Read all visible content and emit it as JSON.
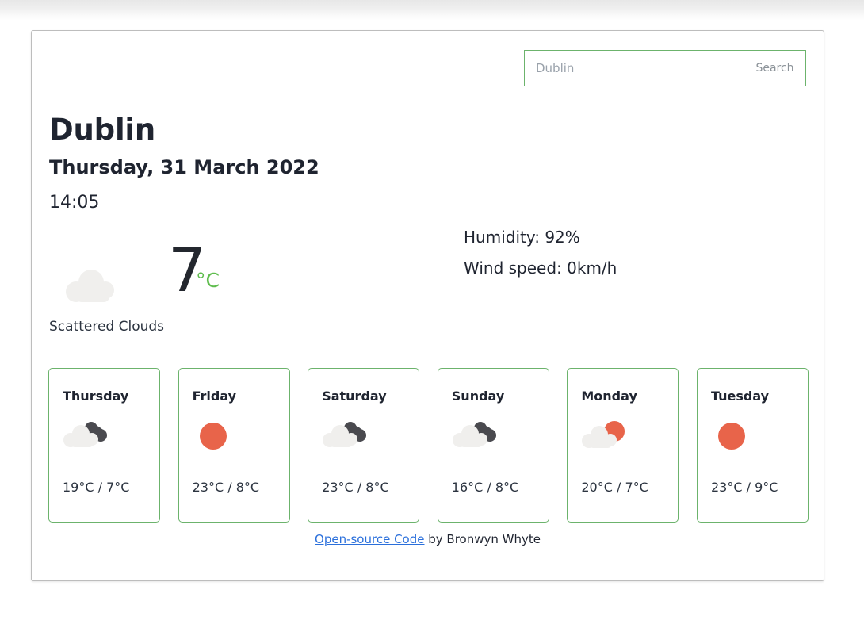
{
  "search": {
    "placeholder": "Dublin",
    "value": "",
    "button_label": "Search"
  },
  "current": {
    "city": "Dublin",
    "date": "Thursday, 31 March 2022",
    "time": "14:05",
    "temperature": "7",
    "unit": "°C",
    "description": "Scattered Clouds",
    "icon": "cloud-icon",
    "humidity_label": "Humidity: 92%",
    "wind_label": "Wind speed: 0km/h"
  },
  "forecast": [
    {
      "day": "Thursday",
      "icon": "broken-clouds-icon",
      "temps": "19°C / 7°C",
      "high": "19°C",
      "low": "7°C"
    },
    {
      "day": "Friday",
      "icon": "sun-icon",
      "temps": "23°C / 8°C",
      "high": "23°C",
      "low": "8°C"
    },
    {
      "day": "Saturday",
      "icon": "broken-clouds-icon",
      "temps": "23°C / 8°C",
      "high": "23°C",
      "low": "8°C"
    },
    {
      "day": "Sunday",
      "icon": "broken-clouds-icon",
      "temps": "16°C / 8°C",
      "high": "16°C",
      "low": "8°C"
    },
    {
      "day": "Monday",
      "icon": "sun-behind-cloud-icon",
      "temps": "20°C / 7°C",
      "high": "20°C",
      "low": "7°C"
    },
    {
      "day": "Tuesday",
      "icon": "sun-icon",
      "temps": "23°C / 9°C",
      "high": "23°C",
      "low": "9°C"
    }
  ],
  "footer": {
    "link_text": "Open-source Code",
    "suffix_text": " by Bronwyn Whyte"
  },
  "colors": {
    "accent_green": "#6cb36c",
    "unit_green": "#5fbd4e",
    "sun_orange": "#e8644a",
    "cloud_light": "#f0efed",
    "cloud_dark": "#4a4a4f",
    "link_blue": "#2a6fdb",
    "text_dark": "#1f2430"
  }
}
